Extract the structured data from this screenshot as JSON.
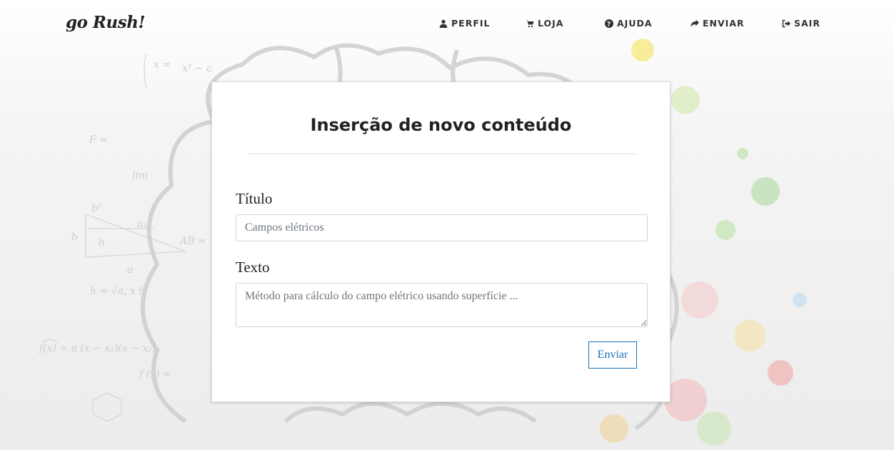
{
  "brand": "go Rush!",
  "nav": {
    "items": [
      {
        "label": "PERFIL",
        "icon": "user-icon"
      },
      {
        "label": "LOJA",
        "icon": "cart-icon"
      },
      {
        "label": "AJUDA",
        "icon": "question-circle-icon"
      },
      {
        "label": "ENVIAR",
        "icon": "share-icon"
      },
      {
        "label": "SAIR",
        "icon": "sign-out-icon"
      }
    ]
  },
  "form": {
    "title": "Inserção de novo conteúdo",
    "title_label": "Título",
    "title_placeholder": "Campos elétricos",
    "text_label": "Texto",
    "text_placeholder": "Método para cálculo do campo elétrico usando superfície ...",
    "submit_label": "Enviar"
  },
  "colors": {
    "accent": "#1a73b8",
    "text": "#222222"
  }
}
